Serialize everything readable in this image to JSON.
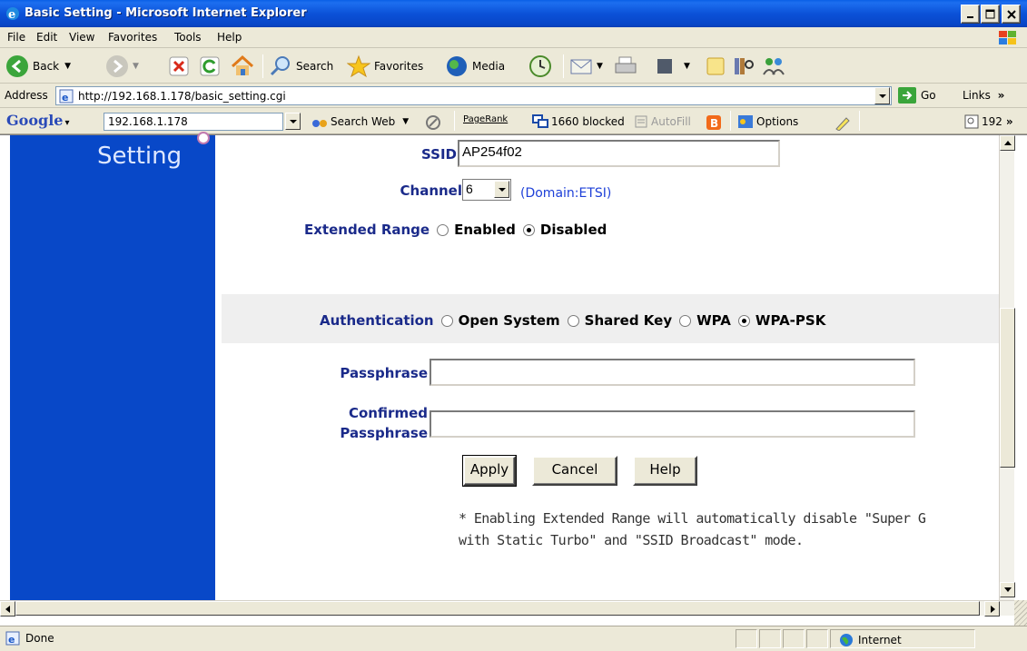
{
  "window": {
    "title": "Basic Setting - Microsoft Internet Explorer",
    "minimize_icon": "minimize-icon",
    "maximize_icon": "maximize-icon",
    "close_icon": "close-icon"
  },
  "menu": {
    "items": [
      "File",
      "Edit",
      "View",
      "Favorites",
      "Tools",
      "Help"
    ]
  },
  "toolbar": {
    "back_label": "Back",
    "search_label": "Search",
    "favorites_label": "Favorites",
    "media_label": "Media"
  },
  "address": {
    "label": "Address",
    "url": "http://192.168.1.178/basic_setting.cgi",
    "go_label": "Go",
    "links_label": "Links"
  },
  "google_bar": {
    "logo": "Google",
    "search_value": "192.168.1.178",
    "search_web_label": "Search Web",
    "pagerank_label": "PageRank",
    "blocked_label": "1660 blocked",
    "autofill_label": "AutoFill",
    "options_label": "Options",
    "tail_label": "192"
  },
  "sidebar": {
    "title": "Setting"
  },
  "form": {
    "ssid_label": "SSID",
    "ssid_value": "AP254f02",
    "channel_label": "Channel",
    "channel_value": "6",
    "channel_domain": "(Domain:ETSI)",
    "extended_range_label": "Extended Range",
    "extended_range_options": [
      "Enabled",
      "Disabled"
    ],
    "extended_range_selected": "Disabled",
    "authentication_label": "Authentication",
    "authentication_options": [
      "Open System",
      "Shared Key",
      "WPA",
      "WPA-PSK"
    ],
    "authentication_selected": "WPA-PSK",
    "passphrase_label": "Passphrase",
    "passphrase_value": "",
    "confirmed_label_line1": "Confirmed",
    "confirmed_label_line2": "Passphrase",
    "confirmed_value": "",
    "apply_label": "Apply",
    "cancel_label": "Cancel",
    "help_label": "Help",
    "note_line1": "* Enabling Extended Range will automatically disable \"Super G",
    "note_line2": "with Static Turbo\" and \"SSID Broadcast\" mode."
  },
  "status": {
    "text": "Done",
    "zone": "Internet"
  },
  "colors": {
    "titlebar": "#0b52d8",
    "sidebar": "#0848c8",
    "label_text": "#1a2a8a",
    "domain_link": "#1e40d8"
  }
}
